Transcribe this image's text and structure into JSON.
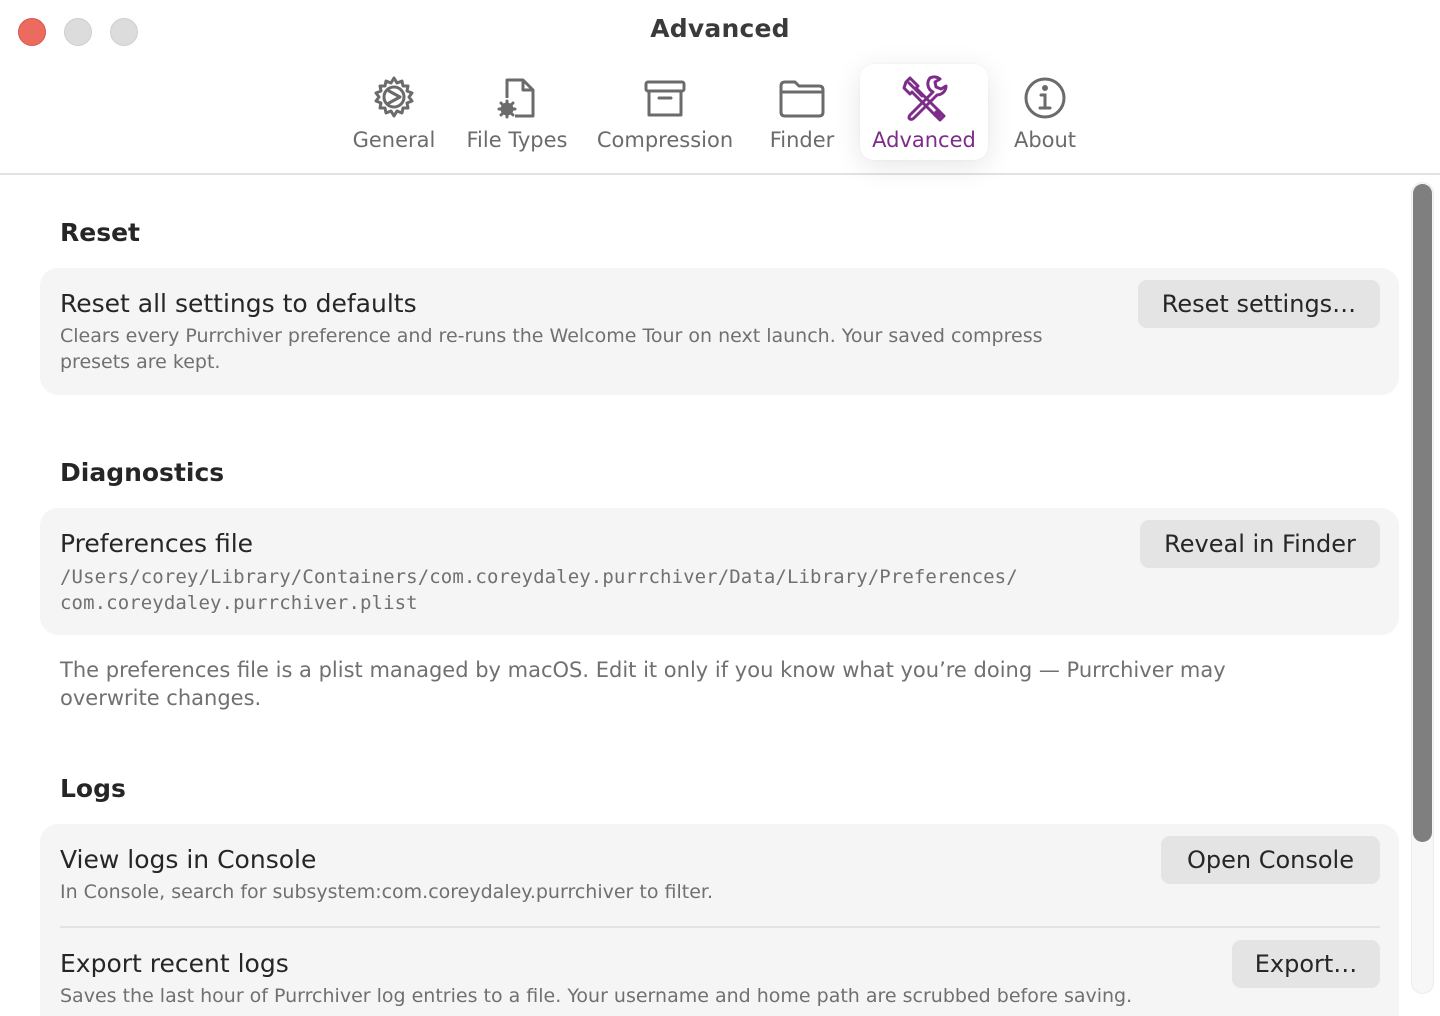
{
  "window": {
    "title": "Advanced",
    "controls": [
      "close",
      "minimize",
      "zoom"
    ]
  },
  "tabs": [
    {
      "label": "General",
      "icon": "gear-icon",
      "active": false
    },
    {
      "label": "File Types",
      "icon": "file-gear-icon",
      "active": false
    },
    {
      "label": "Compression",
      "icon": "archive-box-icon",
      "active": false
    },
    {
      "label": "Finder",
      "icon": "folder-icon",
      "active": false
    },
    {
      "label": "Advanced",
      "icon": "wrench-screwdriver-icon",
      "active": true
    },
    {
      "label": "About",
      "icon": "info-circle-icon",
      "active": false
    }
  ],
  "colors": {
    "accent": "#7d2c8a",
    "close_button": "#ec6a5e",
    "card_background": "#f5f5f5",
    "button_background": "#e4e4e4",
    "secondary_text": "#707070"
  },
  "sections": {
    "reset": {
      "title": "Reset",
      "row": {
        "title": "Reset all settings to defaults",
        "description": "Clears every Purrchiver preference and re-runs the Welcome Tour on next launch. Your saved compress presets are kept.",
        "button": "Reset settings…"
      }
    },
    "diagnostics": {
      "title": "Diagnostics",
      "row": {
        "title": "Preferences file",
        "path_line1": "/Users/corey/Library/Containers/com.coreydaley.purrchiver/Data/Library/Preferences/",
        "path_line2": "com.coreydaley.purrchiver.plist",
        "button": "Reveal in Finder"
      },
      "note": "The preferences file is a plist managed by macOS. Edit it only if you know what you’re doing — Purrchiver may overwrite changes."
    },
    "logs": {
      "title": "Logs",
      "rows": [
        {
          "title": "View logs in Console",
          "description": "In Console, search for subsystem:com.coreydaley.purrchiver to filter.",
          "button": "Open Console"
        },
        {
          "title": "Export recent logs",
          "description": "Saves the last hour of Purrchiver log entries to a file. Your username and home path are scrubbed before saving.",
          "button": "Export…"
        }
      ]
    }
  }
}
